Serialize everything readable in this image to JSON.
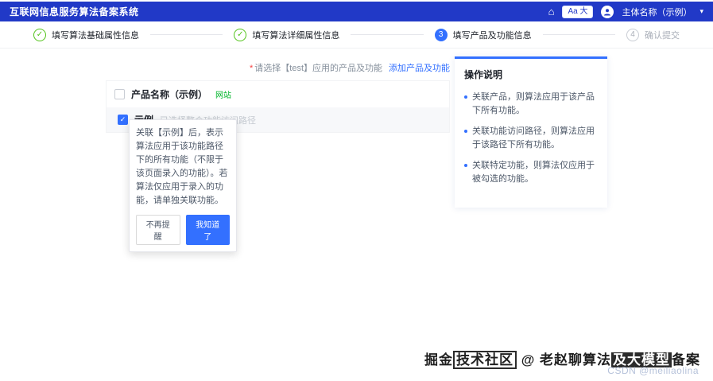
{
  "header": {
    "title": "互联网信息服务算法备案系统",
    "font_size_label": "Aa 大",
    "account": "主体名称（示例）"
  },
  "steps": [
    {
      "label": "填写算法基础属性信息",
      "icon": "✓",
      "state": "done"
    },
    {
      "label": "填写算法详细属性信息",
      "icon": "✓",
      "state": "done"
    },
    {
      "label": "填写产品及功能信息",
      "icon": "3",
      "state": "active"
    },
    {
      "label": "确认提交",
      "icon": "4",
      "state": "pending"
    }
  ],
  "main": {
    "required_mark": "*",
    "select_hint": "请选择【test】应用的产品及功能",
    "add_link": "添加产品及功能",
    "product": {
      "name": "产品名称（示例）",
      "tag": "网站"
    },
    "feature": {
      "name": "示例",
      "status": "已选择整个功能访问路径",
      "check_glyph": "✓"
    },
    "tooltip": {
      "text": "关联【示例】后，表示算法应用于该功能路径下的所有功能（不限于该页面录入的功能）。若算法仅应用于录入的功能，请单独关联功能。",
      "dismiss_label": "不再提醒",
      "confirm_label": "我知道了"
    }
  },
  "side_panel": {
    "title": "操作说明",
    "items": [
      "关联产品，则算法应用于该产品下所有功能。",
      "关联功能访问路径，则算法应用于该路径下所有功能。",
      "关联特定功能，则算法仅应用于被勾选的功能。"
    ]
  },
  "watermark": {
    "segments": [
      {
        "text": "掘金"
      },
      {
        "text": "技术社区"
      },
      {
        "text": " @ 老赵聊算法"
      },
      {
        "text": "及大模型"
      },
      {
        "text": "备案"
      }
    ],
    "sub": "CSDN @meiliaolina"
  },
  "icons": {
    "home": "⌂",
    "chevron_down": "▾"
  },
  "colors": {
    "header_bg": "#2139c7",
    "accent_blue": "#3370ff",
    "success_green": "#52c41a",
    "tag_green": "#00b42a"
  }
}
